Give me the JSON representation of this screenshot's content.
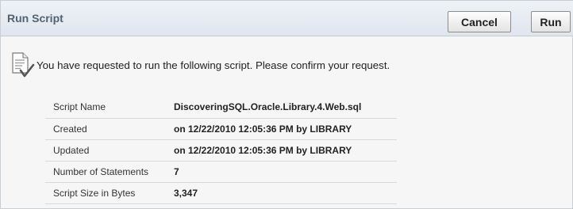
{
  "region": {
    "title": "Run Script",
    "cancel_label": "Cancel",
    "run_label": "Run"
  },
  "confirmation": {
    "icon": "document-check-icon",
    "message": "You have requested to run the following script. Please confirm your request."
  },
  "details": [
    {
      "label": "Script Name",
      "value": "DiscoveringSQL.Oracle.Library.4.Web.sql"
    },
    {
      "label": "Created",
      "value": "on 12/22/2010 12:05:36 PM by LIBRARY"
    },
    {
      "label": "Updated",
      "value": "on 12/22/2010 12:05:36 PM by LIBRARY"
    },
    {
      "label": "Number of Statements",
      "value": "7"
    },
    {
      "label": "Script Size in Bytes",
      "value": "3,347"
    }
  ]
}
